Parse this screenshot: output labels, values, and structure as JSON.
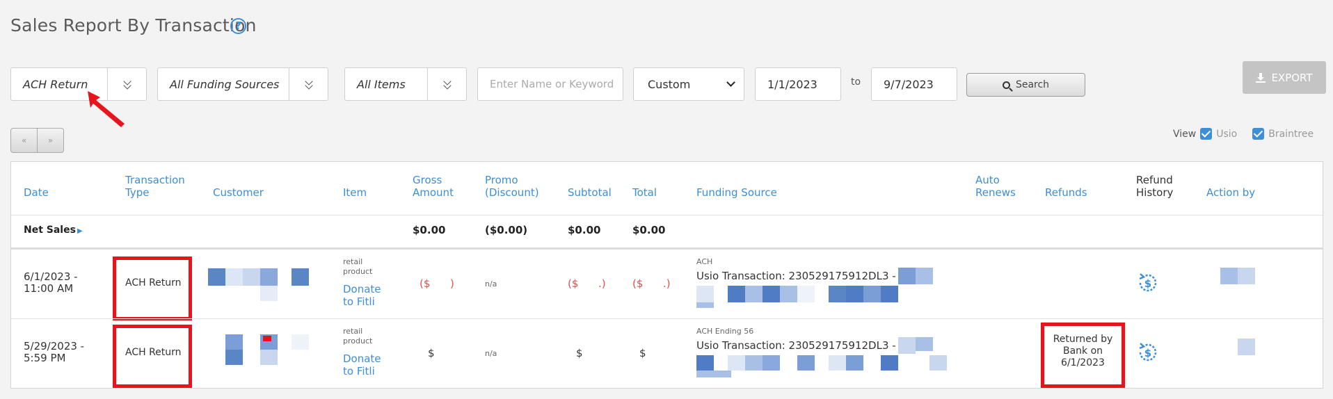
{
  "page": {
    "title": "Sales Report By Transaction",
    "help_icon": "?"
  },
  "filters": {
    "transaction_type": "ACH Return",
    "funding_sources": "All Funding Sources",
    "items": "All Items",
    "keyword_placeholder": "Enter Name or Keyword",
    "date_range": "Custom",
    "date_from": "1/1/2023",
    "to_label": "to",
    "date_to": "9/7/2023",
    "search_label": "Search",
    "export_label": "EXPORT"
  },
  "pager": {
    "prev": "«",
    "next": "»"
  },
  "view": {
    "label": "View",
    "options": [
      {
        "label": "Usio",
        "checked": true
      },
      {
        "label": "Braintree",
        "checked": true
      }
    ]
  },
  "table": {
    "headers": {
      "date": "Date",
      "transaction_type_1": "Transaction",
      "transaction_type_2": "Type",
      "customer": "Customer",
      "item": "Item",
      "gross_1": "Gross",
      "gross_2": "Amount",
      "promo_1": "Promo",
      "promo_2": "(Discount)",
      "subtotal": "Subtotal",
      "total": "Total",
      "funding_source": "Funding Source",
      "auto_1": "Auto",
      "auto_2": "Renews",
      "refunds": "Refunds",
      "refund_history_1": "Refund",
      "refund_history_2": "History",
      "action_by": "Action by"
    },
    "net_sales": {
      "label": "Net Sales",
      "gross": "$0.00",
      "promo": "($0.00)",
      "subtotal": "$0.00",
      "total": "$0.00"
    },
    "rows": [
      {
        "date_1": "6/1/2023 -",
        "date_2": "11:00 AM",
        "type": "ACH Return",
        "item_tiny_1": "retail",
        "item_tiny_2": "product",
        "item_link_1": "Donate",
        "item_link_2": "to Fitli",
        "gross": "($      )",
        "promo": "n/a",
        "subtotal": "($      .)",
        "total": "($      .)",
        "funding_tiny": "ACH",
        "funding_main": "Usio Transaction: 230529175912DL3 -"
      },
      {
        "date_1": "5/29/2023 -",
        "date_2": "5:59 PM",
        "type": "ACH Return",
        "item_tiny_1": "retail",
        "item_tiny_2": "product",
        "item_link_1": "Donate",
        "item_link_2": "to Fitli",
        "gross": "$",
        "promo": "n/a",
        "subtotal": "$",
        "total": "$",
        "funding_tiny": "ACH Ending 56",
        "funding_main": "Usio Transaction: 230529175912DL3 -",
        "refund_1": "Returned by",
        "refund_2": "Bank on",
        "refund_3": "6/1/2023"
      }
    ]
  },
  "icons": {
    "refund_history": "refund-history-icon",
    "search": "search-icon",
    "export": "download-icon"
  },
  "colors": {
    "accent": "#3d8ed6",
    "highlight": "#e8141d",
    "negative": "#d9534f"
  }
}
